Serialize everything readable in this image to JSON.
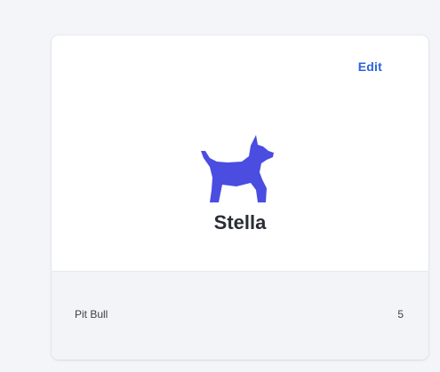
{
  "card": {
    "edit_label": "Edit",
    "icon": "dog-icon",
    "pet_name": "Stella",
    "breed": "Pit Bull",
    "age": "5"
  },
  "colors": {
    "accent": "#2b63d9",
    "icon": "#4a4de0",
    "background": "#f3f5f8",
    "footer_background": "#f2f4f7"
  }
}
